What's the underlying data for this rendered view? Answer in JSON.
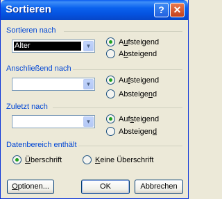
{
  "window": {
    "title": "Sortieren",
    "help_glyph": "?",
    "close_glyph": "✕"
  },
  "groups": [
    {
      "label": "Sortieren nach",
      "combo_value": "Alter",
      "asc": {
        "pre": "A",
        "key": "u",
        "post": "fsteigend"
      },
      "desc": {
        "pre": "A",
        "key": "b",
        "post": "steigend"
      },
      "selected": "asc"
    },
    {
      "label": "Anschließend nach",
      "combo_value": "",
      "asc": {
        "pre": "Au",
        "key": "f",
        "post": "steigend"
      },
      "desc": {
        "pre": "Absteige",
        "key": "n",
        "post": "d"
      },
      "selected": "asc"
    },
    {
      "label": "Zuletzt nach",
      "combo_value": "",
      "asc": {
        "pre": "Auf",
        "key": "s",
        "post": "teigend"
      },
      "desc": {
        "pre": "Absteigen",
        "key": "d",
        "post": ""
      },
      "selected": "asc"
    }
  ],
  "range": {
    "label": "Datenbereich enthält",
    "header": {
      "pre": "",
      "key": "Ü",
      "post": "berschrift"
    },
    "no_header": {
      "pre": "",
      "key": "K",
      "post": "eine Überschrift"
    },
    "selected": "header"
  },
  "buttons": {
    "options": {
      "pre": "",
      "key": "O",
      "post": "ptionen..."
    },
    "ok": "OK",
    "cancel": "Abbrechen"
  }
}
